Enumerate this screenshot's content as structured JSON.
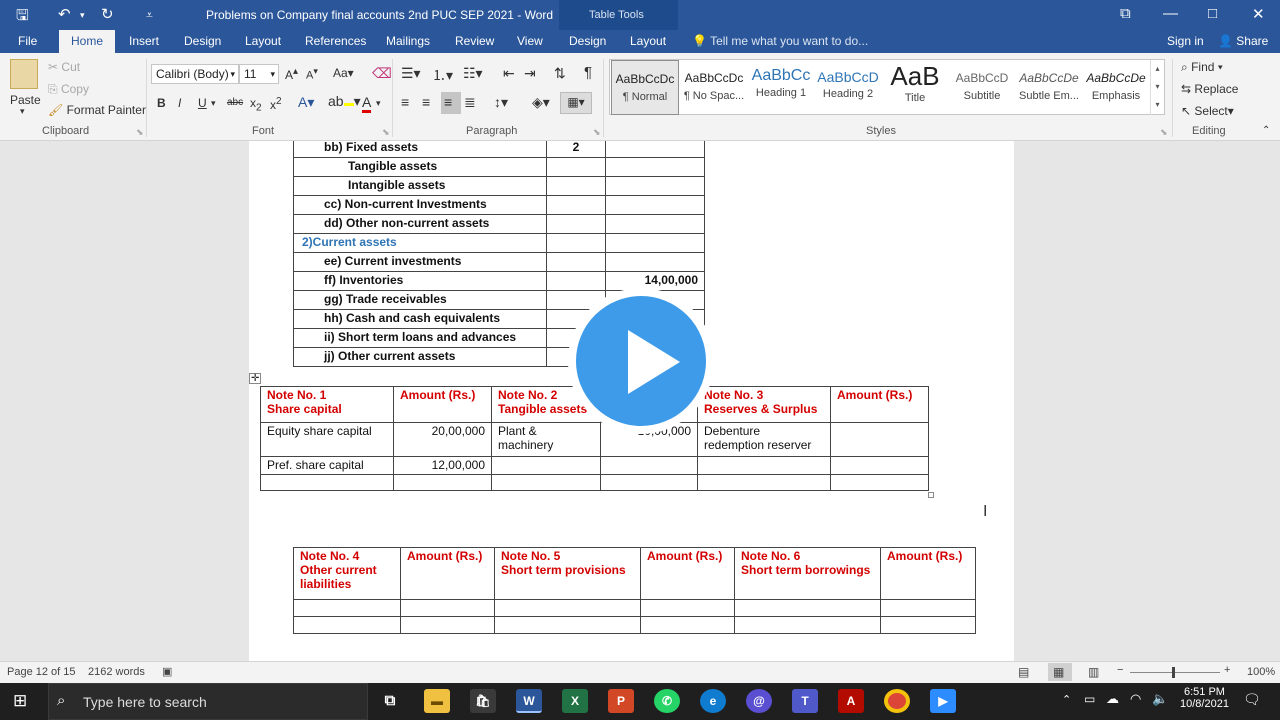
{
  "titlebar": {
    "title": "Problems on Company final accounts 2nd PUC SEP 2021 - Word",
    "contextual": "Table Tools",
    "save": "🖫",
    "undo": "↶",
    "redo": "↻",
    "custom": "⩡",
    "restore": "⧉",
    "minimize": "—",
    "maximize": "□",
    "close": "✕"
  },
  "tabs": [
    "File",
    "Home",
    "Insert",
    "Design",
    "Layout",
    "References",
    "Mailings",
    "Review",
    "View",
    "Design",
    "Layout"
  ],
  "tellme": "Tell me what you want to do...",
  "account": {
    "signin": "Sign in",
    "share": "Share"
  },
  "clipboard": {
    "paste": "Paste",
    "cut": "Cut",
    "copy": "Copy",
    "format_painter": "Format Painter",
    "label": "Clipboard"
  },
  "font": {
    "name": "Calibri (Body)",
    "size": "11",
    "label": "Font"
  },
  "paragraph": {
    "label": "Paragraph"
  },
  "styles": {
    "label": "Styles",
    "items": [
      {
        "preview": "AaBbCcDc",
        "name": "¶ Normal"
      },
      {
        "preview": "AaBbCcDc",
        "name": "¶ No Spac..."
      },
      {
        "preview": "AaBbCc",
        "name": "Heading 1"
      },
      {
        "preview": "AaBbCcD",
        "name": "Heading 2"
      },
      {
        "preview": "AaB",
        "name": "Title"
      },
      {
        "preview": "AaBbCcD",
        "name": "Subtitle"
      },
      {
        "preview": "AaBbCcDe",
        "name": "Subtle Em..."
      },
      {
        "preview": "AaBbCcDe",
        "name": "Emphasis"
      }
    ]
  },
  "editing": {
    "find": "Find",
    "replace": "Replace",
    "select": "Select",
    "label": "Editing"
  },
  "balance_table": [
    {
      "label": "bb) Fixed assets",
      "note": "2",
      "amount": "",
      "indent": 1,
      "style": "b"
    },
    {
      "label": "Tangible assets",
      "note": "",
      "amount": "",
      "indent": 2,
      "style": "b"
    },
    {
      "label": "Intangible assets",
      "note": "",
      "amount": "",
      "indent": 2,
      "style": "b"
    },
    {
      "label": "cc)  Non-current Investments",
      "note": "",
      "amount": "",
      "indent": 1,
      "style": "b"
    },
    {
      "label": "dd) Other non-current assets",
      "note": "",
      "amount": "",
      "indent": 1,
      "style": "b"
    },
    {
      "label": "2)Current assets",
      "note": "",
      "amount": "",
      "indent": 0,
      "style": "blue"
    },
    {
      "label": "ee)  Current investments",
      "note": "",
      "amount": "",
      "indent": 1,
      "style": "b"
    },
    {
      "label": "ff)    Inventories",
      "note": "",
      "amount": "14,00,000",
      "indent": 1,
      "style": "b"
    },
    {
      "label": "gg)  Trade receivables",
      "note": "",
      "amount": "",
      "indent": 1,
      "style": "b"
    },
    {
      "label": "hh) Cash and cash equivalents",
      "note": "",
      "amount": "",
      "indent": 1,
      "style": "b"
    },
    {
      "label": "ii)    Short term loans and advances",
      "note": "",
      "amount": "",
      "indent": 1,
      "style": "b"
    },
    {
      "label": "jj)    Other current assets",
      "note": "",
      "amount": "",
      "indent": 1,
      "style": "b"
    }
  ],
  "notes1": {
    "header": [
      {
        "t": "Note No. 1",
        "t2": "Share capital"
      },
      {
        "t": "Amount (Rs.)",
        "t2": ""
      },
      {
        "t": "Note No. 2",
        "t2": "Tangible assets"
      },
      {
        "t": "",
        "t2": ""
      },
      {
        "t": "Note No. 3",
        "t2": "Reserves & Surplus"
      },
      {
        "t": "Amount (Rs.)",
        "t2": ""
      }
    ],
    "rows": [
      [
        "Equity share capital",
        "20,00,000",
        "Plant &",
        "10,00,000",
        "Debenture",
        "",
        ""
      ],
      [
        "Pref. share capital",
        "12,00,000",
        "",
        "",
        "",
        "",
        ""
      ]
    ],
    "machinery": "machinery",
    "redemption": "redemption reserver"
  },
  "notes2": {
    "header": [
      {
        "t": "Note No. 4",
        "t2": "Other current",
        "t3": "liabilities"
      },
      {
        "t": "Amount (Rs.)"
      },
      {
        "t": "Note No. 5",
        "t2": "Short term provisions"
      },
      {
        "t": "Amount (Rs.)"
      },
      {
        "t": "Note No. 6",
        "t2": "Short term borrowings"
      },
      {
        "t": "Amount (Rs.)"
      }
    ]
  },
  "status": {
    "page": "Page 12 of 15",
    "words": "2162 words",
    "zoom": "100%"
  },
  "taskbar": {
    "search": "Type here to search",
    "time": "6:51 PM",
    "date": "10/8/2021"
  }
}
